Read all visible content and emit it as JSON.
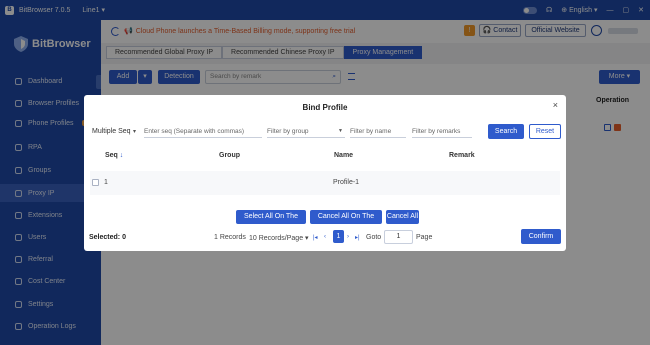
{
  "app": {
    "title": "BitBrowser 7.0.5",
    "line": "Line1",
    "language": "English"
  },
  "brand": {
    "name": "BitBrowser"
  },
  "sidebar": {
    "items": [
      {
        "label": "Dashboard",
        "icon": "dashboard-icon"
      },
      {
        "label": "Browser Profiles",
        "icon": "browser-profiles-icon"
      },
      {
        "label": "Phone Profiles",
        "icon": "phone-icon",
        "badge": "NEW"
      },
      {
        "label": "RPA",
        "icon": "rpa-icon"
      },
      {
        "label": "Groups",
        "icon": "groups-icon"
      },
      {
        "label": "Proxy IP",
        "icon": "proxy-icon",
        "active": true
      },
      {
        "label": "Extensions",
        "icon": "extensions-icon"
      },
      {
        "label": "Users",
        "icon": "users-icon"
      },
      {
        "label": "Referral",
        "icon": "referral-icon"
      },
      {
        "label": "Cost Center",
        "icon": "cost-center-icon"
      },
      {
        "label": "Settings",
        "icon": "settings-icon"
      },
      {
        "label": "Operation Logs",
        "icon": "logs-icon"
      }
    ]
  },
  "header": {
    "notice": "Cloud Phone launches a Time-Based Billing mode, supporting free trial",
    "warning": "!",
    "contact": "Contact",
    "official_website": "Official Website"
  },
  "tabs": [
    "Recommended Global Proxy IP",
    "Recommended Chinese Proxy IP",
    "Proxy Management"
  ],
  "toolbar": {
    "add": "Add",
    "detection": "Detection",
    "search_placeholder": "Search by remark",
    "more": "More"
  },
  "background_table": {
    "operation_header": "Operation"
  },
  "modal": {
    "title": "Bind Profile",
    "close": "×",
    "multiple_seq": "Multiple Seq",
    "seq_placeholder": "Enter seq (Separate with commas)",
    "group_placeholder": "Filter by group",
    "name_placeholder": "Filter by name",
    "remarks_placeholder": "Filter by remarks",
    "search": "Search",
    "reset": "Reset",
    "columns": {
      "seq": "Seq",
      "group": "Group",
      "name": "Name",
      "remark": "Remark"
    },
    "rows": [
      {
        "seq": "1",
        "group": "",
        "name": "Profile-1",
        "remark": ""
      }
    ],
    "select_all_page": "Select All On The Page",
    "cancel_all_page": "Cancel All On The Page",
    "cancel_all": "Cancel All",
    "selected": "Selected: 0",
    "records": "1 Records",
    "per_page": "10 Records/Page",
    "current_page": "1",
    "goto": "Goto",
    "goto_value": "1",
    "page": "Page",
    "confirm": "Confirm"
  },
  "colors": {
    "primary": "#2f5bcc",
    "sidebar": "#1f4aa8",
    "notice": "#e35d2d",
    "warning": "#f39a28"
  }
}
